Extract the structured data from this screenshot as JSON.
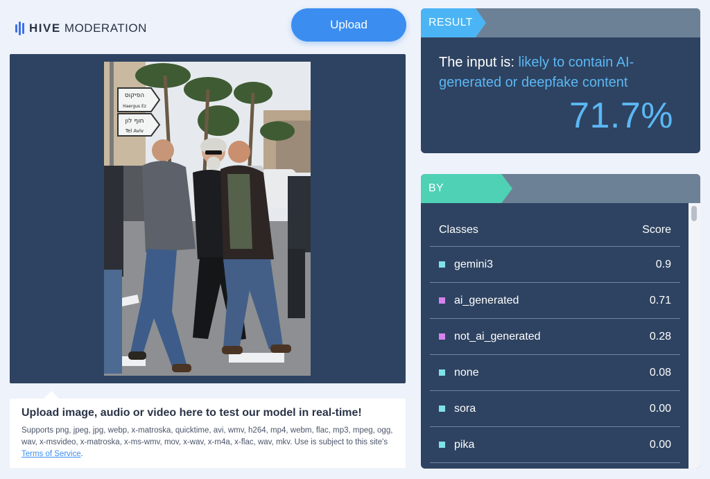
{
  "header": {
    "logo_bold": "HIVE",
    "logo_light": "MODERATION",
    "upload_label": "Upload"
  },
  "upload_info": {
    "title": "Upload image, audio or video here to test our model in real-time!",
    "description": "Supports png, jpeg, jpg, webp, x-matroska, quicktime, avi, wmv, h264, mp4, webm, flac, mp3, mpeg, ogg, wav, x-msvideo, x-matroska, x-ms-wmv, mov, x-wav, x-m4a, x-flac, wav, mkv. Use is subject to this site's ",
    "terms_link": "Terms of Service",
    "terms_suffix": "."
  },
  "photo": {
    "sign_top_hebrew": "הפיקוס",
    "sign_top_latin": "Haergus Ez",
    "sign_bottom_hebrew": "חוף לון",
    "sign_bottom_latin": "Tel Aviv"
  },
  "result": {
    "tag": "RESULT",
    "prefix": "The input is: ",
    "verdict": "likely to contain AI-generated or deepfake content",
    "score": "71.7%"
  },
  "classes": {
    "tag": "BY CLASSES",
    "col_class": "Classes",
    "col_score": "Score",
    "rows": [
      {
        "name": "gemini3",
        "score": "0.9",
        "color": "#7fe3e6"
      },
      {
        "name": "ai_generated",
        "score": "0.71",
        "color": "#d483ee"
      },
      {
        "name": "not_ai_generated",
        "score": "0.28",
        "color": "#d483ee"
      },
      {
        "name": "none",
        "score": "0.08",
        "color": "#7fe3e6"
      },
      {
        "name": "sora",
        "score": "0.00",
        "color": "#7fe3e6"
      },
      {
        "name": "pika",
        "score": "0.00",
        "color": "#7fe3e6"
      }
    ]
  },
  "colors": {
    "accent": "#3b8ef0",
    "panel": "#2e4361",
    "result_highlight": "#5bb8f5",
    "classes_tag": "#4fd1b5"
  }
}
